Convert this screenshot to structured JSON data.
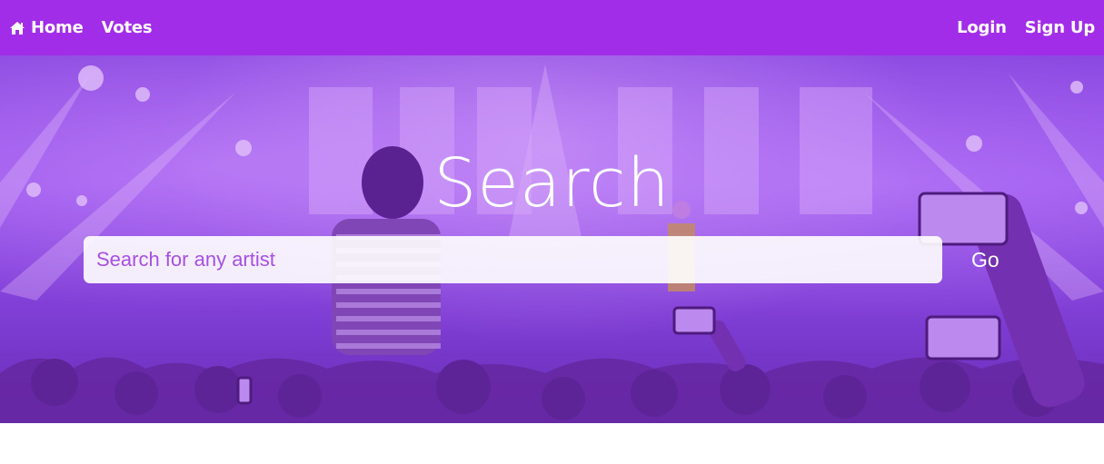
{
  "nav": {
    "home_label": "Home",
    "votes_label": "Votes",
    "login_label": "Login",
    "signup_label": "Sign Up",
    "home_icon": "home-icon",
    "bg_color": "#a22de8"
  },
  "hero": {
    "title": "Search",
    "search_placeholder": "Search for any artist",
    "search_value": "",
    "go_label": "Go",
    "placeholder_color": "#a650e2"
  }
}
